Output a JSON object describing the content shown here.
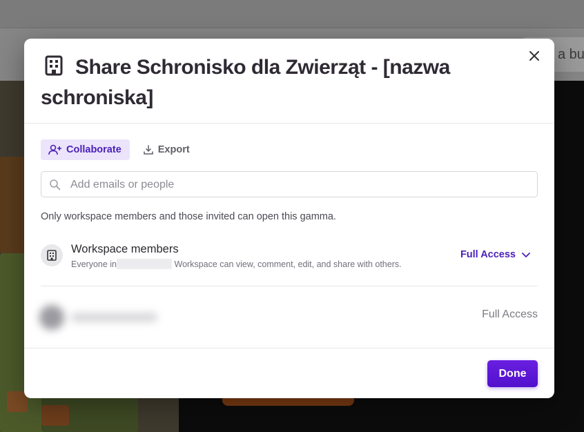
{
  "background": {
    "toolbar_pill_text": "a bu"
  },
  "modal": {
    "title": "Share Schronisko dla Zwierząt - [nazwa schroniska]",
    "title_icon": "building-icon",
    "close_icon": "close-icon",
    "tabs": [
      {
        "label": "Collaborate",
        "icon": "add-user-icon",
        "active": true
      },
      {
        "label": "Export",
        "icon": "download-icon",
        "active": false
      }
    ],
    "search": {
      "placeholder": "Add emails or people",
      "value": ""
    },
    "access_note": "Only workspace members and those invited can open this gamma.",
    "workspace_row": {
      "name": "Workspace members",
      "desc_prefix": "Everyone in",
      "desc_suffix": "Workspace can view, comment, edit, and share with others.",
      "access": "Full Access",
      "icon": "building-icon"
    },
    "owner_row": {
      "access": "Full Access"
    },
    "done_label": "Done"
  },
  "colors": {
    "accent": "#5110cc",
    "tab_active_bg": "#ece4fb",
    "text_primary": "#2f2a33"
  }
}
